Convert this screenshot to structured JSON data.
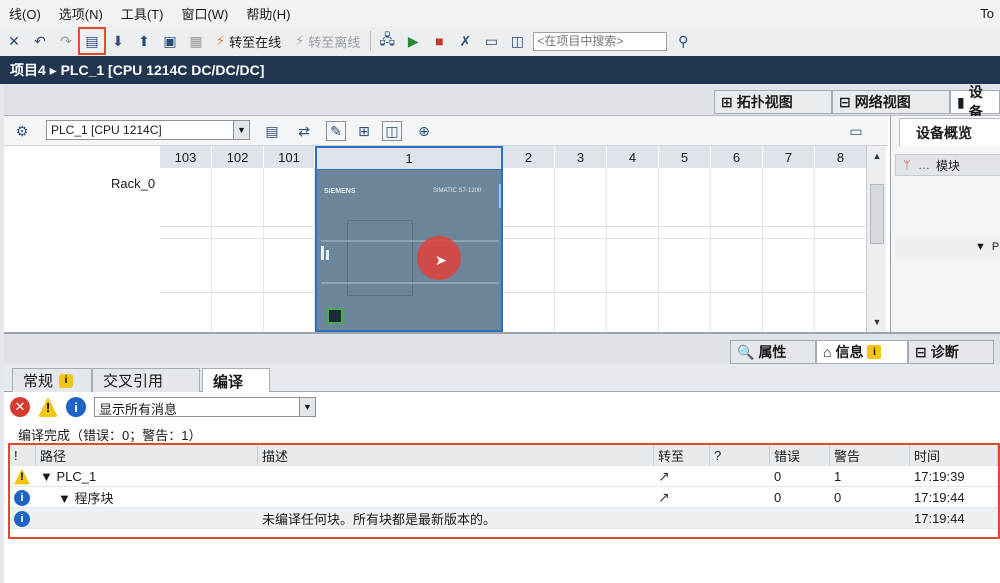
{
  "menubar": {
    "items": [
      "线(O)",
      "选项(N)",
      "工具(T)",
      "窗口(W)",
      "帮助(H)"
    ],
    "brand": "To"
  },
  "toolbar": {
    "go_online": "转至在线",
    "go_offline": "转至离线",
    "search_placeholder": "<在项目中搜索>"
  },
  "titlebar": {
    "path": "项目4 ▸ PLC_1 [CPU 1214C DC/DC/DC]"
  },
  "view_tabs": {
    "topology": "拓扑视图",
    "network": "网络视图",
    "device": "设备"
  },
  "device_view": {
    "device_select": "PLC_1 [CPU 1214C]",
    "rack_name": "Rack_0",
    "slots": [
      "103",
      "102",
      "101",
      "1",
      "2",
      "3",
      "4",
      "5",
      "6",
      "7",
      "8"
    ],
    "plc_brand": "SIEMENS",
    "plc_model": "SIMATIC S7-1200"
  },
  "overview": {
    "tab": "设备概览",
    "col_module": "模块",
    "row_marker": "P"
  },
  "inspector_tabs": {
    "properties": "属性",
    "info": "信息",
    "diagnostics": "诊断"
  },
  "sub_tabs": {
    "general": "常规",
    "crossref": "交叉引用",
    "compile": "编译"
  },
  "messages": {
    "filter": "显示所有消息",
    "summary": "编译完成（错误：0；警告：1）",
    "columns": [
      "!",
      "路径",
      "描述",
      "转至",
      "?",
      "错误",
      "警告",
      "时间"
    ],
    "rows": [
      {
        "icon": "warning",
        "path": "▼ PLC_1",
        "desc": "",
        "goto": "↗",
        "errors": "0",
        "warnings": "1",
        "time": "17:19:39"
      },
      {
        "icon": "info",
        "path": "▼ 程序块",
        "desc": "",
        "goto": "↗",
        "errors": "0",
        "warnings": "0",
        "time": "17:19:44"
      },
      {
        "icon": "info",
        "path": "",
        "desc": "未编译任何块。所有块都是最新版本的。",
        "goto": "",
        "errors": "",
        "warnings": "",
        "time": "17:19:44"
      }
    ]
  },
  "colors": {
    "title_bg": "#1f3550",
    "highlight": "#e3472e",
    "plc_body": "#6d8598",
    "selection": "#2f6fbf"
  }
}
